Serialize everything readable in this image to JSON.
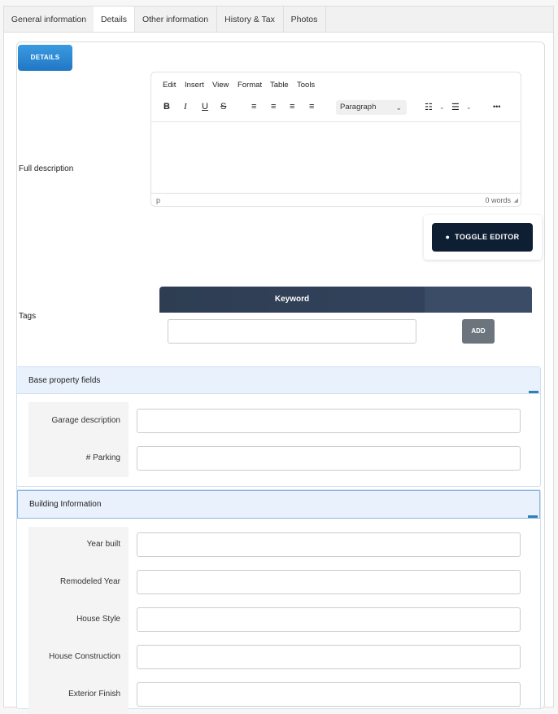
{
  "tabs": [
    "General information",
    "Details",
    "Other information",
    "History & Tax",
    "Photos"
  ],
  "details_button": "DETAILS",
  "full_description_label": "Full description",
  "editor": {
    "menu": [
      "Edit",
      "Insert",
      "View",
      "Format",
      "Table",
      "Tools"
    ],
    "toolbar": {
      "bold": "B",
      "italic": "I",
      "underline": "U",
      "strike": "S",
      "align_left": "≡",
      "align_center": "≡",
      "align_right": "≡",
      "justify": "≡",
      "block_format": "Paragraph",
      "more": "•••"
    },
    "status_path": "p",
    "word_count": "0 words"
  },
  "toggle_editor": "TOGGLE EDITOR",
  "tags_label": "Tags",
  "keyword_header": "Keyword",
  "add_button": "ADD",
  "base_section": {
    "title": "Base property fields",
    "fields": [
      "Garage description",
      "# Parking"
    ]
  },
  "building_section": {
    "title": "Building Information",
    "fields": [
      "Year built",
      "Remodeled Year",
      "House Style",
      "House Construction",
      "Exterior Finish"
    ]
  },
  "colors": {
    "accent": "#2f7fb8",
    "dark_button": "#0f1f33",
    "section_header": "#e9f1fc"
  }
}
